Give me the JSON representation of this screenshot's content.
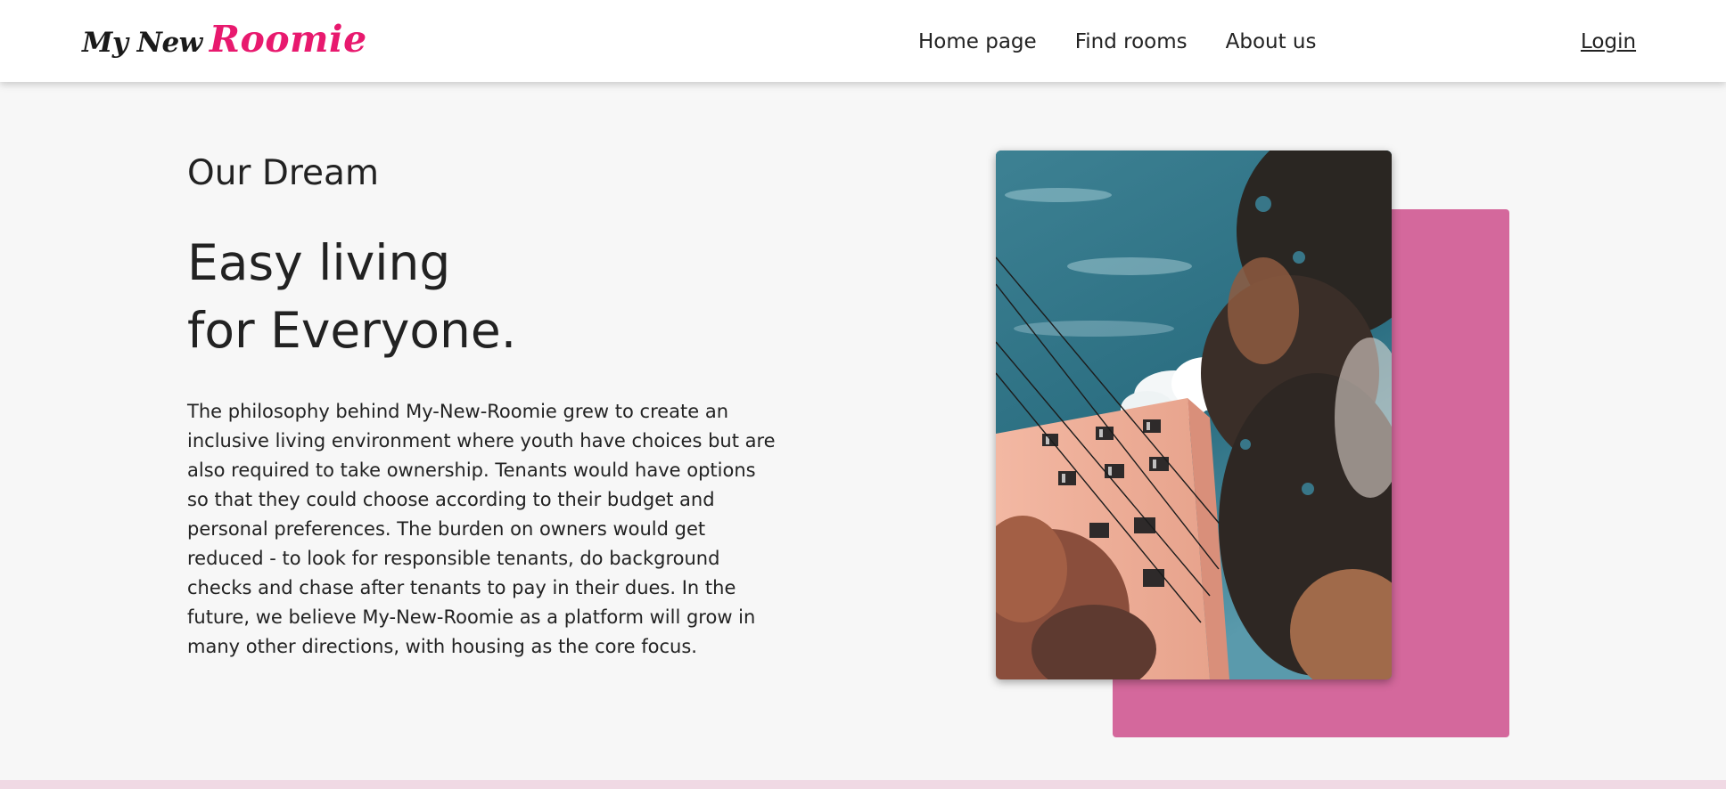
{
  "header": {
    "logo": {
      "part1": "My New",
      "part2": "Roomie"
    },
    "nav": [
      {
        "label": "Home page"
      },
      {
        "label": "Find rooms"
      },
      {
        "label": "About us"
      }
    ],
    "login_label": "Login"
  },
  "main": {
    "eyebrow": "Our Dream",
    "headline_line1": "Easy living",
    "headline_line2": "for Everyone.",
    "body": "The philosophy behind My-New-Roomie grew to create an inclusive living environment where youth have choices but are also required to take ownership. Tenants would have options so that they could choose according to their budget and personal preferences. The burden on owners would get reduced - to look for responsible tenants, do background checks and chase after tenants to pay in their dues. In the future, we believe My-New-Roomie as a platform will grow in many other directions, with housing as the core focus."
  },
  "colors": {
    "brand_pink": "#e8196e",
    "accent_block": "#d4689c",
    "page_background": "#f7f7f7",
    "navbar_background": "#ffffff"
  }
}
